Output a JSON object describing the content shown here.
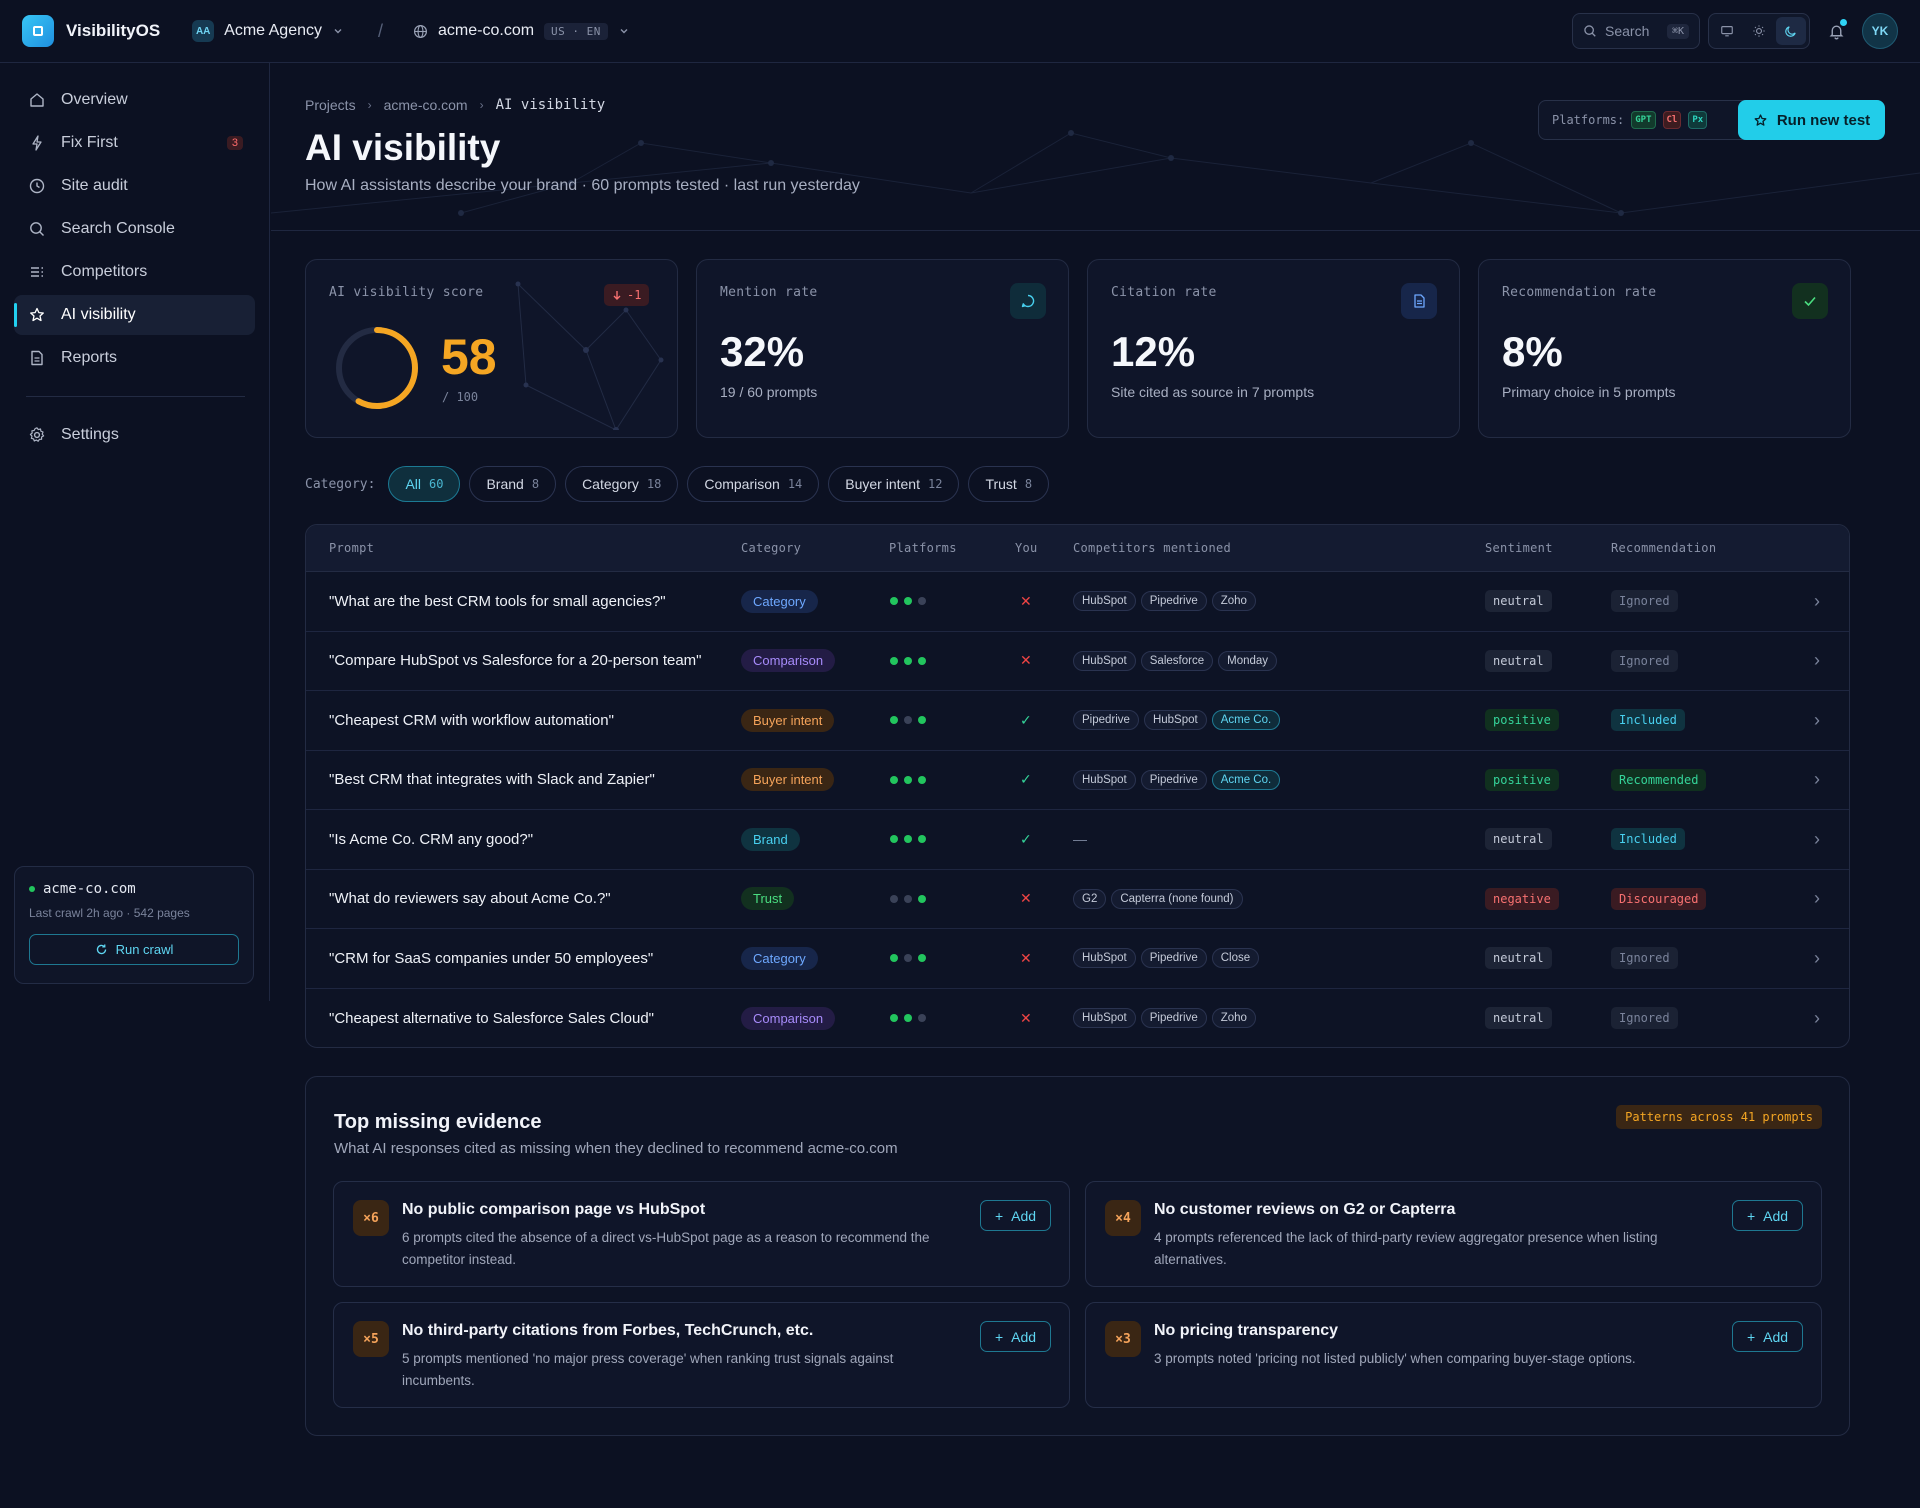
{
  "app": {
    "name": "VisibilityOS"
  },
  "topbar": {
    "org_initials": "AA",
    "org_name": "Acme Agency",
    "separator": "/",
    "site": "acme-co.com",
    "locale": "US · EN",
    "search_placeholder": "Search",
    "search_shortcut": "⌘K",
    "avatar_initials": "YK"
  },
  "sidebar": {
    "items": [
      {
        "label": "Overview",
        "icon": "home-icon"
      },
      {
        "label": "Fix First",
        "icon": "bolt-icon",
        "badge": "3"
      },
      {
        "label": "Site audit",
        "icon": "clock-icon"
      },
      {
        "label": "Search Console",
        "icon": "search-icon"
      },
      {
        "label": "Competitors",
        "icon": "list-icon"
      },
      {
        "label": "AI visibility",
        "icon": "star-icon",
        "active": true
      },
      {
        "label": "Reports",
        "icon": "file-icon"
      }
    ],
    "settings_label": "Settings",
    "crawl": {
      "site": "acme-co.com",
      "meta": "Last crawl 2h ago · 542 pages",
      "button": "Run crawl"
    }
  },
  "header": {
    "breadcrumb": [
      "Projects",
      "acme-co.com",
      "AI visibility"
    ],
    "title": "AI visibility",
    "subtitle": "How AI assistants describe your brand · 60 prompts tested · last run yesterday",
    "platforms_label": "Platforms:",
    "platform_chips": [
      "GPT",
      "Cl",
      "Px"
    ],
    "run_button": "Run new test"
  },
  "stats": {
    "score": {
      "label": "AI visibility score",
      "value": "58",
      "max": "/ 100",
      "delta": "-1",
      "fraction": 0.58
    },
    "mention": {
      "label": "Mention rate",
      "value": "32%",
      "sub": "19 / 60 prompts"
    },
    "citation": {
      "label": "Citation rate",
      "value": "12%",
      "sub": "Site cited as source in 7 prompts"
    },
    "recommendation": {
      "label": "Recommendation rate",
      "value": "8%",
      "sub": "Primary choice in 5 prompts"
    }
  },
  "filters": {
    "label": "Category:",
    "chips": [
      {
        "label": "All",
        "count": "60",
        "active": true
      },
      {
        "label": "Brand",
        "count": "8"
      },
      {
        "label": "Category",
        "count": "18"
      },
      {
        "label": "Comparison",
        "count": "14"
      },
      {
        "label": "Buyer intent",
        "count": "12"
      },
      {
        "label": "Trust",
        "count": "8"
      }
    ]
  },
  "table": {
    "headers": [
      "Prompt",
      "Category",
      "Platforms",
      "You",
      "Competitors mentioned",
      "Sentiment",
      "Recommendation"
    ],
    "rows": [
      {
        "prompt": "\"What are the best CRM tools for small agencies?\"",
        "category": "Category",
        "cat_key": "Category",
        "platforms": [
          1,
          1,
          0
        ],
        "you": false,
        "competitors": [
          "HubSpot",
          "Pipedrive",
          "Zoho"
        ],
        "sentiment": "neutral",
        "recommendation": "Ignored"
      },
      {
        "prompt": "\"Compare HubSpot vs Salesforce for a 20-person team\"",
        "category": "Comparison",
        "cat_key": "Comparison",
        "platforms": [
          1,
          1,
          1
        ],
        "you": false,
        "competitors": [
          "HubSpot",
          "Salesforce",
          "Monday"
        ],
        "sentiment": "neutral",
        "recommendation": "Ignored"
      },
      {
        "prompt": "\"Cheapest CRM with workflow automation\"",
        "category": "Buyer intent",
        "cat_key": "Buyer",
        "platforms": [
          1,
          0,
          1
        ],
        "you": true,
        "competitors": [
          "Pipedrive",
          "HubSpot",
          "Acme Co."
        ],
        "sentiment": "positive",
        "recommendation": "Included"
      },
      {
        "prompt": "\"Best CRM that integrates with Slack and Zapier\"",
        "category": "Buyer intent",
        "cat_key": "Buyer",
        "platforms": [
          1,
          1,
          1
        ],
        "you": true,
        "competitors": [
          "HubSpot",
          "Pipedrive",
          "Acme Co."
        ],
        "sentiment": "positive",
        "recommendation": "Recommended"
      },
      {
        "prompt": "\"Is Acme Co. CRM any good?\"",
        "category": "Brand",
        "cat_key": "Brand",
        "platforms": [
          1,
          1,
          1
        ],
        "you": true,
        "competitors": [],
        "sentiment": "neutral",
        "recommendation": "Included"
      },
      {
        "prompt": "\"What do reviewers say about Acme Co.?\"",
        "category": "Trust",
        "cat_key": "Trust",
        "platforms": [
          0,
          0,
          1
        ],
        "you": false,
        "competitors": [
          "G2",
          "Capterra (none found)"
        ],
        "sentiment": "negative",
        "recommendation": "Discouraged"
      },
      {
        "prompt": "\"CRM for SaaS companies under 50 employees\"",
        "category": "Category",
        "cat_key": "Category",
        "platforms": [
          1,
          0,
          1
        ],
        "you": false,
        "competitors": [
          "HubSpot",
          "Pipedrive",
          "Close"
        ],
        "sentiment": "neutral",
        "recommendation": "Ignored"
      },
      {
        "prompt": "\"Cheapest alternative to Salesforce Sales Cloud\"",
        "category": "Comparison",
        "cat_key": "Comparison",
        "platforms": [
          1,
          1,
          0
        ],
        "you": false,
        "competitors": [
          "HubSpot",
          "Pipedrive",
          "Zoho"
        ],
        "sentiment": "neutral",
        "recommendation": "Ignored"
      }
    ],
    "self_brand": "Acme Co.",
    "empty_competitors": "—"
  },
  "evidence": {
    "title": "Top missing evidence",
    "subtitle": "What AI responses cited as missing when they declined to recommend acme-co.com",
    "badge": "Patterns across 41 prompts",
    "add_label": "Add",
    "cards": [
      {
        "count": "×6",
        "title": "No public comparison page vs HubSpot",
        "desc": "6 prompts cited the absence of a direct vs-HubSpot page as a reason to recommend the competitor instead."
      },
      {
        "count": "×4",
        "title": "No customer reviews on G2 or Capterra",
        "desc": "4 prompts referenced the lack of third-party review aggregator presence when listing alternatives."
      },
      {
        "count": "×5",
        "title": "No third-party citations from Forbes, TechCrunch, etc.",
        "desc": "5 prompts mentioned 'no major press coverage' when ranking trust signals against incumbents."
      },
      {
        "count": "×3",
        "title": "No pricing transparency",
        "desc": "3 prompts noted 'pricing not listed publicly' when comparing buyer-stage options."
      }
    ]
  },
  "colors": {
    "accent": "#22cde9",
    "score": "#f5a623",
    "positive": "#22c55e",
    "negative": "#ef4444"
  }
}
